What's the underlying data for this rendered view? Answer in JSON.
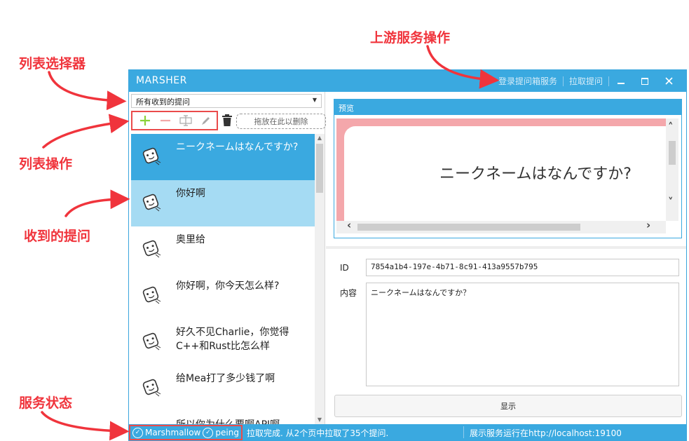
{
  "annotations": {
    "list_selector": "列表选择器",
    "list_actions": "列表操作",
    "received_questions": "收到的提问",
    "service_status": "服务状态",
    "upstream_actions": "上游服务操作"
  },
  "window": {
    "title": "MARSHER",
    "login_link": "登录提问箱服务",
    "fetch_link": "拉取提问",
    "minimize_icon": "minimize-icon",
    "maximize_icon": "maximize-icon",
    "close_icon": "close-icon"
  },
  "left_pane": {
    "selector_value": "所有收到的提问",
    "drop_zone": "拖放在此以删除",
    "icons": [
      "add-icon",
      "remove-icon",
      "rename-icon",
      "edit-icon",
      "trash-icon"
    ],
    "items": [
      {
        "text": "ニークネームはなんですか?"
      },
      {
        "text": "你好啊"
      },
      {
        "text": "奥里给"
      },
      {
        "text": "你好啊，你今天怎么样?"
      },
      {
        "text": "好久不见Charlie，你觉得C++和Rust比怎么样"
      },
      {
        "text": "给Mea打了多少钱了啊"
      },
      {
        "text": "所以你为什么要啊API啊"
      }
    ]
  },
  "preview": {
    "header": "预览",
    "bubble_text": "ニークネームはなんですか?"
  },
  "details": {
    "id_label": "ID",
    "id_value": "7854a1b4-197e-4b71-8c91-413a9557b795",
    "content_label": "内容",
    "content_value": "ニークネームはなんですか？",
    "show_button": "显示"
  },
  "statusbar": {
    "services": [
      "Marshmallow",
      "peing"
    ],
    "message": "拉取完成. 从2个页中拉取了35个提问.",
    "server": "展示服务运行在http://localhost:19100"
  },
  "colors": {
    "accent": "#3aa9e0",
    "selected_row": "#3aa9e0",
    "hover_row": "#a5dbf3",
    "preview_bg": "#f4a7ab",
    "annotation": "#f0343c"
  }
}
